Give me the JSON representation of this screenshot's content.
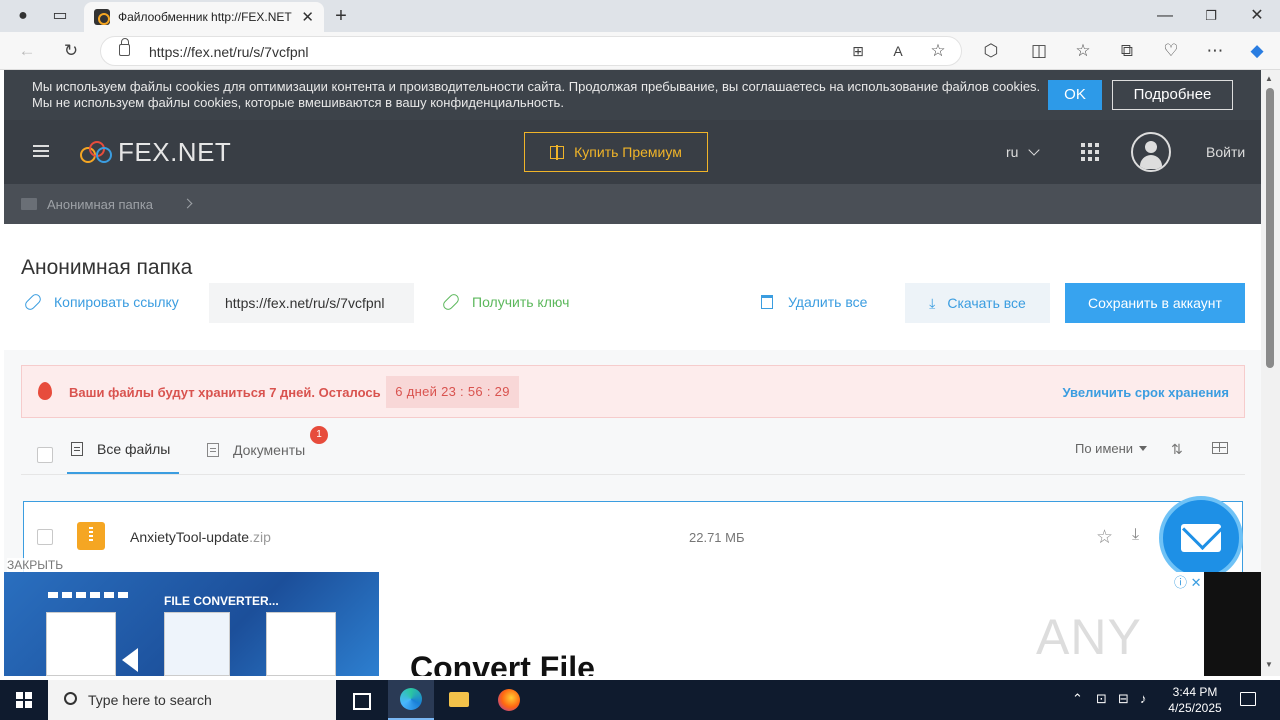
{
  "browser": {
    "tab_title": "Файлообменник http://FEX.NET",
    "url": "https://fex.net/ru/s/7vcfpnl"
  },
  "cookie": {
    "message": "Мы используем файлы cookies для оптимизации контента и производительности сайта. Продолжая пребывание, вы соглашаетесь на использование файлов cookies. Мы не используем файлы cookies, которые вмешиваются в вашу конфиденциальность.",
    "ok_label": "OK",
    "more_label": "Подробнее"
  },
  "header": {
    "logo_text": "FEX.NET",
    "premium_label": "Купить Премиум",
    "lang": "ru",
    "login_label": "Войти"
  },
  "breadcrumb": {
    "folder_label": "Анонимная папка"
  },
  "folder": {
    "title": "Анонимная папка",
    "copy_link_label": "Копировать ссылку",
    "share_url": "https://fex.net/ru/s/7vcfpnl",
    "get_key_label": "Получить ключ",
    "delete_all_label": "Удалить все",
    "download_all_label": "Скачать все",
    "save_account_label": "Сохранить в аккаунт"
  },
  "alert": {
    "message": "Ваши файлы будут храниться 7 дней. Осталось",
    "timer": "6 дней  23 : 56 : 29",
    "extend_label": "Увеличить срок хранения"
  },
  "tabs": {
    "all_label": "Все файлы",
    "docs_label": "Документы",
    "docs_badge": "1",
    "sort_label": "По имени"
  },
  "files": [
    {
      "name": "AnxietyTool-update",
      "ext": ".zip",
      "size": "22.71 МБ"
    }
  ],
  "ad": {
    "close_label": "ЗАКРЫТЬ",
    "banner_text": "FILE CONVERTER...",
    "title": "Convert File"
  },
  "watermark": "ANY RUN",
  "taskbar": {
    "search_placeholder": "Type here to search",
    "time": "3:44 PM",
    "date": "4/25/2025"
  },
  "colors": {
    "accent": "#37a3ef",
    "header_bg": "#393e45",
    "alert_red": "#d9534f",
    "premium_gold": "#f0b429"
  }
}
